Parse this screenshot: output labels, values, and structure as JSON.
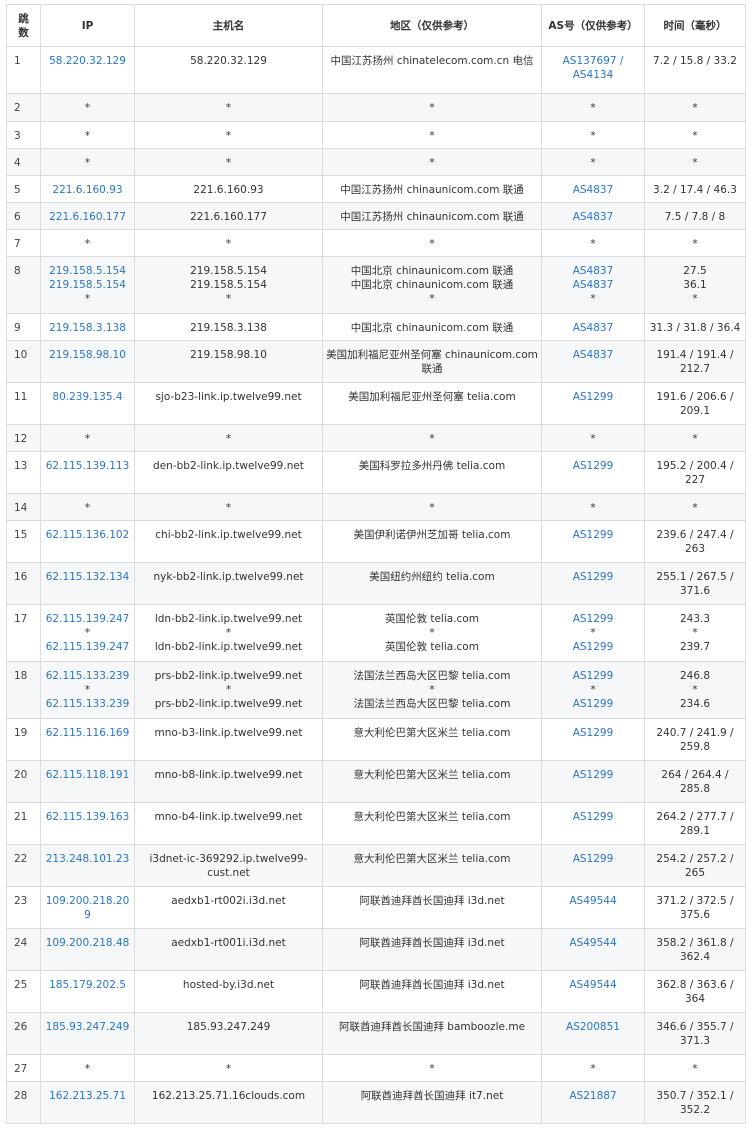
{
  "header": {
    "hop": "跳\n数",
    "ip": "IP",
    "host": "主机名",
    "region": "地区（仅供参考）",
    "asn": "AS号（仅供参考）",
    "time": "时间（毫秒）"
  },
  "rows": [
    {
      "hop": "1",
      "ip": [
        "58.220.32.129"
      ],
      "host": [
        "58.220.32.129"
      ],
      "region": [
        "中国江苏扬州 chinatelecom.com.cn 电信"
      ],
      "asn": [
        "AS137697 /",
        "AS4134"
      ],
      "time": [
        "7.2 / 15.8 / 33.2"
      ]
    },
    {
      "hop": "2",
      "ip": [
        "*"
      ],
      "host": [
        "*"
      ],
      "region": [
        "*"
      ],
      "asn": [
        "*"
      ],
      "time": [
        "*"
      ]
    },
    {
      "hop": "3",
      "ip": [
        "*"
      ],
      "host": [
        "*"
      ],
      "region": [
        "*"
      ],
      "asn": [
        "*"
      ],
      "time": [
        "*"
      ]
    },
    {
      "hop": "4",
      "ip": [
        "*"
      ],
      "host": [
        "*"
      ],
      "region": [
        "*"
      ],
      "asn": [
        "*"
      ],
      "time": [
        "*"
      ]
    },
    {
      "hop": "5",
      "ip": [
        "221.6.160.93"
      ],
      "host": [
        "221.6.160.93"
      ],
      "region": [
        "中国江苏扬州 chinaunicom.com 联通"
      ],
      "asn": [
        "AS4837"
      ],
      "time": [
        "3.2 / 17.4 / 46.3"
      ]
    },
    {
      "hop": "6",
      "ip": [
        "221.6.160.177"
      ],
      "host": [
        "221.6.160.177"
      ],
      "region": [
        "中国江苏扬州 chinaunicom.com 联通"
      ],
      "asn": [
        "AS4837"
      ],
      "time": [
        "7.5 / 7.8 / 8"
      ]
    },
    {
      "hop": "7",
      "ip": [
        "*"
      ],
      "host": [
        "*"
      ],
      "region": [
        "*"
      ],
      "asn": [
        "*"
      ],
      "time": [
        "*"
      ]
    },
    {
      "hop": "8",
      "ip": [
        "219.158.5.154",
        "219.158.5.154",
        "*"
      ],
      "host": [
        "219.158.5.154",
        "219.158.5.154",
        "*"
      ],
      "region": [
        "中国北京 chinaunicom.com 联通",
        "中国北京 chinaunicom.com 联通",
        "*"
      ],
      "asn": [
        "AS4837",
        "AS4837",
        "*"
      ],
      "time": [
        "27.5",
        "36.1",
        "*"
      ]
    },
    {
      "hop": "9",
      "ip": [
        "219.158.3.138"
      ],
      "host": [
        "219.158.3.138"
      ],
      "region": [
        "中国北京 chinaunicom.com 联通"
      ],
      "asn": [
        "AS4837"
      ],
      "time": [
        "31.3 / 31.8 / 36.4"
      ]
    },
    {
      "hop": "10",
      "ip": [
        "219.158.98.10"
      ],
      "host": [
        "219.158.98.10"
      ],
      "region": [
        "美国加利福尼亚州圣何塞 chinaunicom.com",
        "联通"
      ],
      "asn": [
        "AS4837"
      ],
      "time": [
        "191.4 / 191.4 /",
        "212.7"
      ]
    },
    {
      "hop": "11",
      "ip": [
        "80.239.135.4"
      ],
      "host": [
        "sjo-b23-link.ip.twelve99.net"
      ],
      "region": [
        "美国加利福尼亚州圣何塞 telia.com"
      ],
      "asn": [
        "AS1299"
      ],
      "time": [
        "191.6 / 206.6 /",
        "209.1"
      ]
    },
    {
      "hop": "12",
      "ip": [
        "*"
      ],
      "host": [
        "*"
      ],
      "region": [
        "*"
      ],
      "asn": [
        "*"
      ],
      "time": [
        "*"
      ]
    },
    {
      "hop": "13",
      "ip": [
        "62.115.139.113"
      ],
      "host": [
        "den-bb2-link.ip.twelve99.net"
      ],
      "region": [
        "美国科罗拉多州丹佛 telia.com"
      ],
      "asn": [
        "AS1299"
      ],
      "time": [
        "195.2 / 200.4 /",
        "227"
      ]
    },
    {
      "hop": "14",
      "ip": [
        "*"
      ],
      "host": [
        "*"
      ],
      "region": [
        "*"
      ],
      "asn": [
        "*"
      ],
      "time": [
        "*"
      ]
    },
    {
      "hop": "15",
      "ip": [
        "62.115.136.102"
      ],
      "host": [
        "chi-bb2-link.ip.twelve99.net"
      ],
      "region": [
        "美国伊利诺伊州芝加哥 telia.com"
      ],
      "asn": [
        "AS1299"
      ],
      "time": [
        "239.6 / 247.4 /",
        "263"
      ]
    },
    {
      "hop": "16",
      "ip": [
        "62.115.132.134"
      ],
      "host": [
        "nyk-bb2-link.ip.twelve99.net"
      ],
      "region": [
        "美国纽约州纽约 telia.com"
      ],
      "asn": [
        "AS1299"
      ],
      "time": [
        "255.1 / 267.5 /",
        "371.6"
      ]
    },
    {
      "hop": "17",
      "ip": [
        "62.115.139.247",
        "*",
        "62.115.139.247"
      ],
      "host": [
        "ldn-bb2-link.ip.twelve99.net",
        "*",
        "ldn-bb2-link.ip.twelve99.net"
      ],
      "region": [
        "英国伦敦 telia.com",
        "*",
        "英国伦敦 telia.com"
      ],
      "asn": [
        "AS1299",
        "*",
        "AS1299"
      ],
      "time": [
        "243.3",
        "*",
        "239.7"
      ]
    },
    {
      "hop": "18",
      "ip": [
        "62.115.133.239",
        "*",
        "62.115.133.239"
      ],
      "host": [
        "prs-bb2-link.ip.twelve99.net",
        "*",
        "prs-bb2-link.ip.twelve99.net"
      ],
      "region": [
        "法国法兰西岛大区巴黎 telia.com",
        "*",
        "法国法兰西岛大区巴黎 telia.com"
      ],
      "asn": [
        "AS1299",
        "*",
        "AS1299"
      ],
      "time": [
        "246.8",
        "*",
        "234.6"
      ]
    },
    {
      "hop": "19",
      "ip": [
        "62.115.116.169"
      ],
      "host": [
        "mno-b3-link.ip.twelve99.net"
      ],
      "region": [
        "意大利伦巴第大区米兰 telia.com"
      ],
      "asn": [
        "AS1299"
      ],
      "time": [
        "240.7 / 241.9 /",
        "259.8"
      ]
    },
    {
      "hop": "20",
      "ip": [
        "62.115.118.191"
      ],
      "host": [
        "mno-b8-link.ip.twelve99.net"
      ],
      "region": [
        "意大利伦巴第大区米兰 telia.com"
      ],
      "asn": [
        "AS1299"
      ],
      "time": [
        "264 / 264.4 /",
        "285.8"
      ]
    },
    {
      "hop": "21",
      "ip": [
        "62.115.139.163"
      ],
      "host": [
        "mno-b4-link.ip.twelve99.net"
      ],
      "region": [
        "意大利伦巴第大区米兰 telia.com"
      ],
      "asn": [
        "AS1299"
      ],
      "time": [
        "264.2 / 277.7 /",
        "289.1"
      ]
    },
    {
      "hop": "22",
      "ip": [
        "213.248.101.23"
      ],
      "host": [
        "i3dnet-ic-369292.ip.twelve99-",
        "cust.net"
      ],
      "region": [
        "意大利伦巴第大区米兰 telia.com"
      ],
      "asn": [
        "AS1299"
      ],
      "time": [
        "254.2 / 257.2 /",
        "265"
      ]
    },
    {
      "hop": "23",
      "ip": [
        "109.200.218.209"
      ],
      "host": [
        "aedxb1-rt002i.i3d.net"
      ],
      "region": [
        "阿联酋迪拜酋长国迪拜 i3d.net"
      ],
      "asn": [
        "AS49544"
      ],
      "time": [
        "371.2 / 372.5 /",
        "375.6"
      ]
    },
    {
      "hop": "24",
      "ip": [
        "109.200.218.48"
      ],
      "host": [
        "aedxb1-rt001i.i3d.net"
      ],
      "region": [
        "阿联酋迪拜酋长国迪拜 i3d.net"
      ],
      "asn": [
        "AS49544"
      ],
      "time": [
        "358.2 / 361.8 /",
        "362.4"
      ]
    },
    {
      "hop": "25",
      "ip": [
        "185.179.202.5"
      ],
      "host": [
        "hosted-by.i3d.net"
      ],
      "region": [
        "阿联酋迪拜酋长国迪拜 i3d.net"
      ],
      "asn": [
        "AS49544"
      ],
      "time": [
        "362.8 / 363.6 /",
        "364"
      ]
    },
    {
      "hop": "26",
      "ip": [
        "185.93.247.249"
      ],
      "host": [
        "185.93.247.249"
      ],
      "region": [
        "阿联酋迪拜酋长国迪拜 bamboozle.me"
      ],
      "asn": [
        "AS200851"
      ],
      "time": [
        "346.6 / 355.7 /",
        "371.3"
      ]
    },
    {
      "hop": "27",
      "ip": [
        "*"
      ],
      "host": [
        "*"
      ],
      "region": [
        "*"
      ],
      "asn": [
        "*"
      ],
      "time": [
        "*"
      ]
    },
    {
      "hop": "28",
      "ip": [
        "162.213.25.71"
      ],
      "host": [
        "162.213.25.71.16clouds.com"
      ],
      "region": [
        "阿联酋迪拜酋长国迪拜 it7.net"
      ],
      "asn": [
        "AS21887"
      ],
      "time": [
        "350.7 / 352.1 /",
        "352.2"
      ]
    }
  ]
}
